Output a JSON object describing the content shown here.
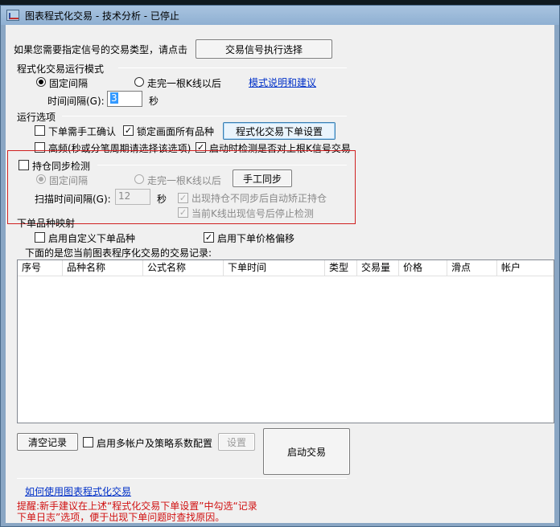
{
  "window": {
    "title": "图表程式化交易 - 技术分析 - 已停止"
  },
  "header": {
    "prompt": "如果您需要指定信号的交易类型，请点击",
    "signal_button": "交易信号执行选择"
  },
  "run_mode": {
    "section_label": "程式化交易运行模式",
    "fixed_interval_label": "固定间隔",
    "fixed_interval_selected": true,
    "after_kline_label": "走完一根K线以后",
    "explain_link": "模式说明和建议",
    "interval_label": "时间间隔(G):",
    "interval_value": "3",
    "interval_unit": "秒"
  },
  "run_options": {
    "section_label": "运行选项",
    "manual_confirm_label": "下单需手工确认",
    "manual_confirm_checked": false,
    "lock_all_label": "锁定画面所有品种",
    "lock_all_checked": true,
    "order_settings_button": "程式化交易下单设置",
    "high_freq_label": "高频(秒或分笔周期请选择该选项)",
    "high_freq_checked": false,
    "startup_check_label": "启动时检测是否对上根K信号交易",
    "startup_check_checked": true
  },
  "position_sync": {
    "section_label": "持仓同步检测",
    "enabled": false,
    "fixed_interval_label": "固定间隔",
    "after_kline_label": "走完一根K线以后",
    "manual_sync_button": "手工同步",
    "scan_interval_label": "扫描时间间隔(G):",
    "scan_interval_value": "12",
    "scan_interval_unit": "秒",
    "auto_correct_label": "出现持仓不同步后自动矫正持仓",
    "auto_correct_checked": true,
    "stop_check_label": "当前K线出现信号后停止检测",
    "stop_check_checked": true
  },
  "order_mapping": {
    "section_label": "下单品种映射",
    "custom_symbol_label": "启用自定义下单品种",
    "custom_symbol_checked": false,
    "price_offset_label": "启用下单价格偏移",
    "price_offset_checked": true,
    "records_label": "下面的是您当前图表程序化交易的交易记录:"
  },
  "records_table": {
    "columns": [
      "序号",
      "品种名称",
      "公式名称",
      "下单时间",
      "类型",
      "交易量",
      "价格",
      "滑点",
      "帐户"
    ],
    "rows": []
  },
  "footer": {
    "clear_button": "清空记录",
    "multi_account_label": "启用多帐户及策略系数配置",
    "multi_account_checked": false,
    "settings_button": "设置",
    "start_button": "启动交易",
    "howto_link": "如何使用图表程式化交易",
    "tip_text_line1": "提醒:新手建议在上述“程式化交易下单设置”中勾选“记录",
    "tip_text_line2": "下单日志”选项，便于出现下单问题时查找原因。"
  },
  "colors": {
    "highlight_box": "#d02020",
    "link": "#0030c8",
    "tip_text": "#d01010",
    "titlebar": "#9ab8d8"
  }
}
